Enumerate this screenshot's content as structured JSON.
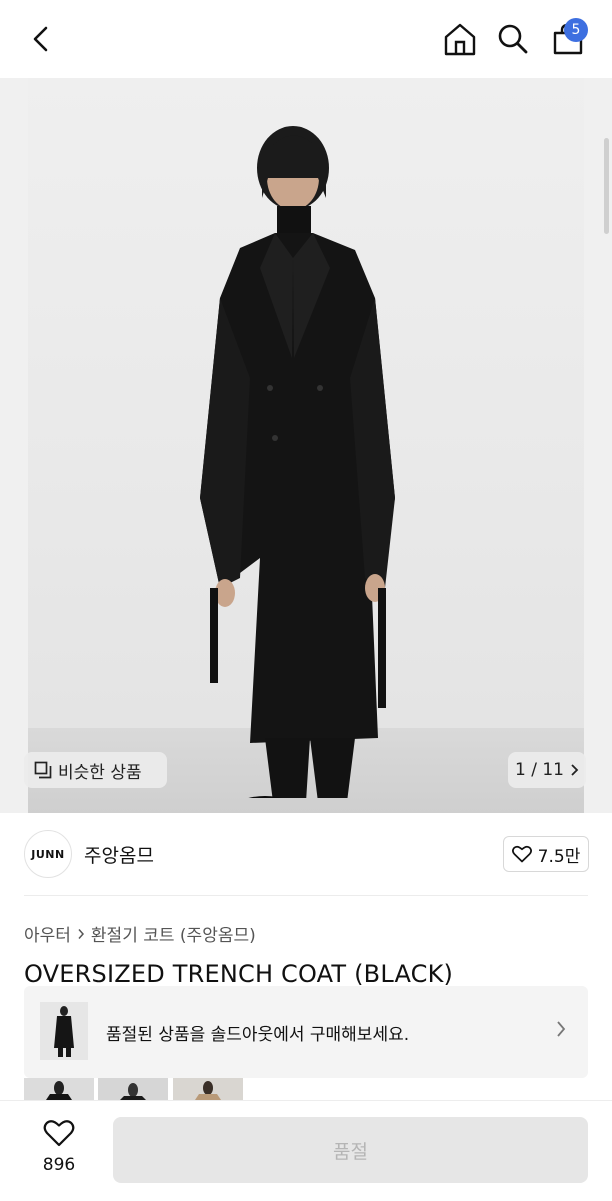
{
  "header": {
    "cart_badge": "5"
  },
  "gallery": {
    "similar_label": "비슷한 상품",
    "counter": "1 / 11"
  },
  "brand": {
    "logo_text": "JUNN",
    "name": "주앙옴므",
    "likes": "7.5만"
  },
  "breadcrumb": {
    "category": "아우터",
    "subcategory": "환절기 코트 (주앙옴므)"
  },
  "product": {
    "title": "OVERSIZED TRENCH COAT (BLACK)"
  },
  "soldout_banner": {
    "text": "품절된 상품을 솔드아웃에서 구매해보세요."
  },
  "bottom_bar": {
    "wish_count": "896",
    "buy_label": "품절"
  },
  "icons": {
    "back": "chevron-left-icon",
    "home": "home-icon",
    "search": "search-icon",
    "cart": "bag-icon",
    "heart": "heart-icon",
    "similar": "copy-icon"
  }
}
